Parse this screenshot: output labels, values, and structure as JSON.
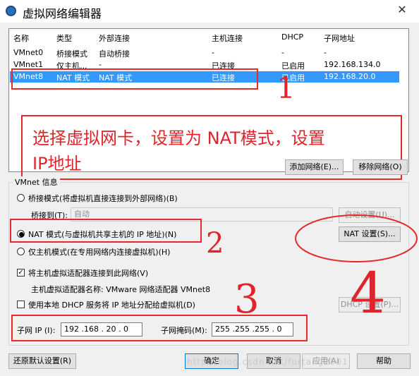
{
  "window": {
    "title": "虚拟网络编辑器",
    "close_glyph": "✕"
  },
  "table": {
    "columns": [
      "名称",
      "类型",
      "外部连接",
      "主机连接",
      "DHCP",
      "子网地址"
    ],
    "rows": [
      [
        "VMnet0",
        "桥接模式",
        "自动桥接",
        "-",
        "-",
        "-"
      ],
      [
        "VMnet1",
        "仅主机...",
        "-",
        "已连接",
        "已启用",
        "192.168.134.0"
      ],
      [
        "VMnet8",
        "NAT 模式",
        "NAT 模式",
        "已连接",
        "已启用",
        "192.168.20.0"
      ]
    ]
  },
  "annotation": {
    "text": "选择虚拟网卡，设置为 NAT模式，设置IP地址",
    "line1": "选择虚拟网卡，设置为 NAT模式，设置",
    "line2": "IP地址",
    "num1": "1",
    "num2": "2",
    "num3": "3",
    "num4": "4"
  },
  "buttons": {
    "add_network": "添加网络(E)...",
    "remove_network": "移除网络(O)",
    "auto_settings": "自动设置(U)...",
    "nat_settings": "NAT 设置(S)...",
    "dhcp_settings": "DHCP 设置(P)...",
    "restore_defaults": "还原默认设置(R)",
    "ok": "确定",
    "cancel": "取消",
    "apply": "应用(A)",
    "help": "帮助"
  },
  "vmnet_info": {
    "legend": "VMnet 信息",
    "bridged_label": "桥接模式(将虚拟机直接连接到外部网络)(B)",
    "bridged_to_label": "桥接到(T):",
    "bridged_to_value": "自动",
    "nat_label": "NAT 模式(与虚拟机共享主机的 IP 地址)(N)",
    "host_only_label": "仅主机模式(在专用网络内连接虚拟机)(H)",
    "connect_adapter_label": "将主机虚拟适配器连接到此网络(V)",
    "connect_adapter_checked": true,
    "adapter_name_label": "主机虚拟适配器名称: VMware 网络适配器 VMnet8",
    "use_dhcp_label": "使用本地 DHCP 服务将 IP 地址分配给虚拟机(D)",
    "use_dhcp_checked": false,
    "subnet_ip_label": "子网 IP (I):",
    "subnet_ip_value": "192 .168 . 20 . 0",
    "subnet_mask_label": "子网掩码(M):",
    "subnet_mask_value": "255 .255 .255 . 0",
    "selected_mode": "nat"
  },
  "watermark": "http://blog.csdn.net/furtang2001"
}
